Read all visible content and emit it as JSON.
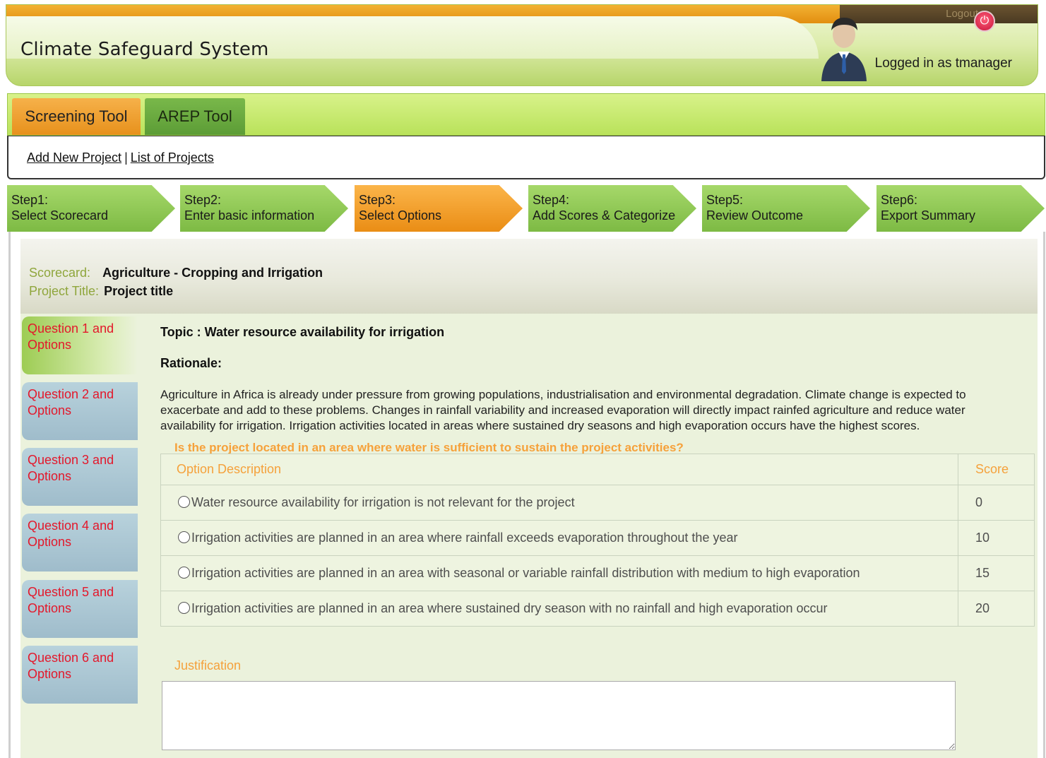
{
  "app": {
    "title": "Climate Safeguard System",
    "logout_label": "Logout",
    "logged_in_text": "Logged in as tmanager"
  },
  "tool_tabs": [
    {
      "label": "Screening Tool",
      "active": true
    },
    {
      "label": "AREP Tool",
      "active": false
    }
  ],
  "sub_links": {
    "add_project": "Add New Project",
    "separator": "|",
    "list_projects": "List of Projects"
  },
  "steps": [
    {
      "title": "Step1:",
      "subtitle": "Select Scorecard",
      "active": false
    },
    {
      "title": "Step2:",
      "subtitle": "Enter basic information",
      "active": false
    },
    {
      "title": "Step3:",
      "subtitle": "Select Options",
      "active": true
    },
    {
      "title": "Step4:",
      "subtitle": "Add Scores & Categorize",
      "active": false
    },
    {
      "title": "Step5:",
      "subtitle": "Review Outcome",
      "active": false
    },
    {
      "title": "Step6:",
      "subtitle": "Export Summary",
      "active": false
    }
  ],
  "info": {
    "scorecard_label": "Scorecard:",
    "scorecard_value": "Agriculture - Cropping and Irrigation",
    "project_title_label": "Project Title:",
    "project_title_value": "Project title"
  },
  "question_tabs": [
    {
      "label": "Question 1 and Options",
      "active": true
    },
    {
      "label": "Question 2 and Options",
      "active": false
    },
    {
      "label": "Question 3 and Options",
      "active": false
    },
    {
      "label": "Question 4 and Options",
      "active": false
    },
    {
      "label": "Question 5 and Options",
      "active": false
    },
    {
      "label": "Question 6 and Options",
      "active": false
    }
  ],
  "question": {
    "topic": "Topic : Water resource availability for irrigation",
    "rationale_heading": "Rationale:",
    "rationale_text": "Agriculture in Africa is already under pressure from growing populations, industrialisation and environmental degradation. Climate change is expected to exacerbate and add to these problems. Changes in rainfall variability and increased evaporation will directly impact rainfed agriculture and reduce water availability for irrigation. Irrigation activities located in areas where sustained dry seasons and high evaporation occurs have the highest scores.",
    "prompt": "Is the project located in an area where water is sufficient to sustain the project activities?"
  },
  "options_table": {
    "headers": {
      "description": "Option Description",
      "score": "Score"
    },
    "rows": [
      {
        "description": "Water resource availability for irrigation is not relevant for the project",
        "score": "0"
      },
      {
        "description": "Irrigation activities are planned in an area where rainfall exceeds evaporation throughout the year",
        "score": "10"
      },
      {
        "description": "Irrigation activities are planned in an area with seasonal or variable rainfall distribution with medium to high evaporation",
        "score": "15"
      },
      {
        "description": "Irrigation activities are planned in an area where sustained dry season with no rainfall and high evaporation occur",
        "score": "20"
      }
    ]
  },
  "justification": {
    "label": "Justification",
    "value": ""
  },
  "icons": {
    "logout": "power-icon",
    "avatar": "user-avatar-icon",
    "radio": "radio-button-icon"
  },
  "colors": {
    "accent_orange": "#ea8d15",
    "accent_green": "#7dba44",
    "question_red": "#e3182b",
    "label_orange": "#f5a13b"
  }
}
